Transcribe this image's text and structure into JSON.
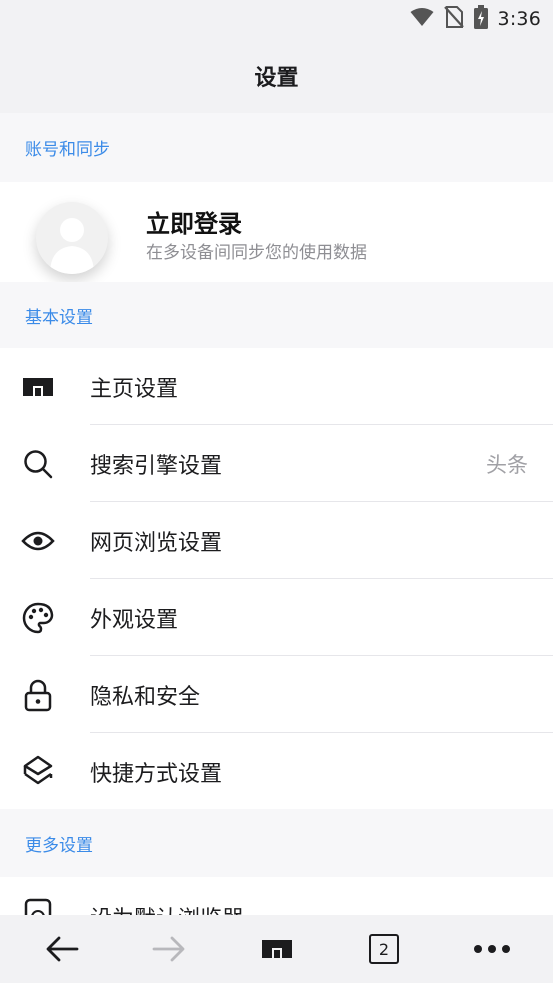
{
  "status_bar": {
    "time": "3:36",
    "icons": [
      "wifi-icon",
      "no-sim-icon",
      "battery-charging-icon"
    ]
  },
  "header": {
    "title": "设置"
  },
  "sections": {
    "account": {
      "title": "账号和同步"
    },
    "basic": {
      "title": "基本设置"
    },
    "more": {
      "title": "更多设置"
    }
  },
  "account": {
    "login_title": "立即登录",
    "login_subtitle": "在多设备间同步您的使用数据"
  },
  "basic_items": [
    {
      "label": "主页设置",
      "icon": "home-icon",
      "value": ""
    },
    {
      "label": "搜索引擎设置",
      "icon": "search-icon",
      "value": "头条"
    },
    {
      "label": "网页浏览设置",
      "icon": "eye-icon",
      "value": ""
    },
    {
      "label": "外观设置",
      "icon": "palette-icon",
      "value": ""
    },
    {
      "label": "隐私和安全",
      "icon": "lock-icon",
      "value": ""
    },
    {
      "label": "快捷方式设置",
      "icon": "shortcut-icon",
      "value": ""
    }
  ],
  "more_items": [
    {
      "label": "设为默认浏览器",
      "icon": "default-browser-icon"
    }
  ],
  "bottom_nav": {
    "items": [
      "back-icon",
      "forward-icon",
      "home-icon",
      "tabs-icon",
      "more-icon"
    ],
    "tab_count": "2"
  },
  "colors": {
    "accent": "#3b8be8",
    "background": "#f6f6f8",
    "secondary_text": "#8e8e93"
  }
}
